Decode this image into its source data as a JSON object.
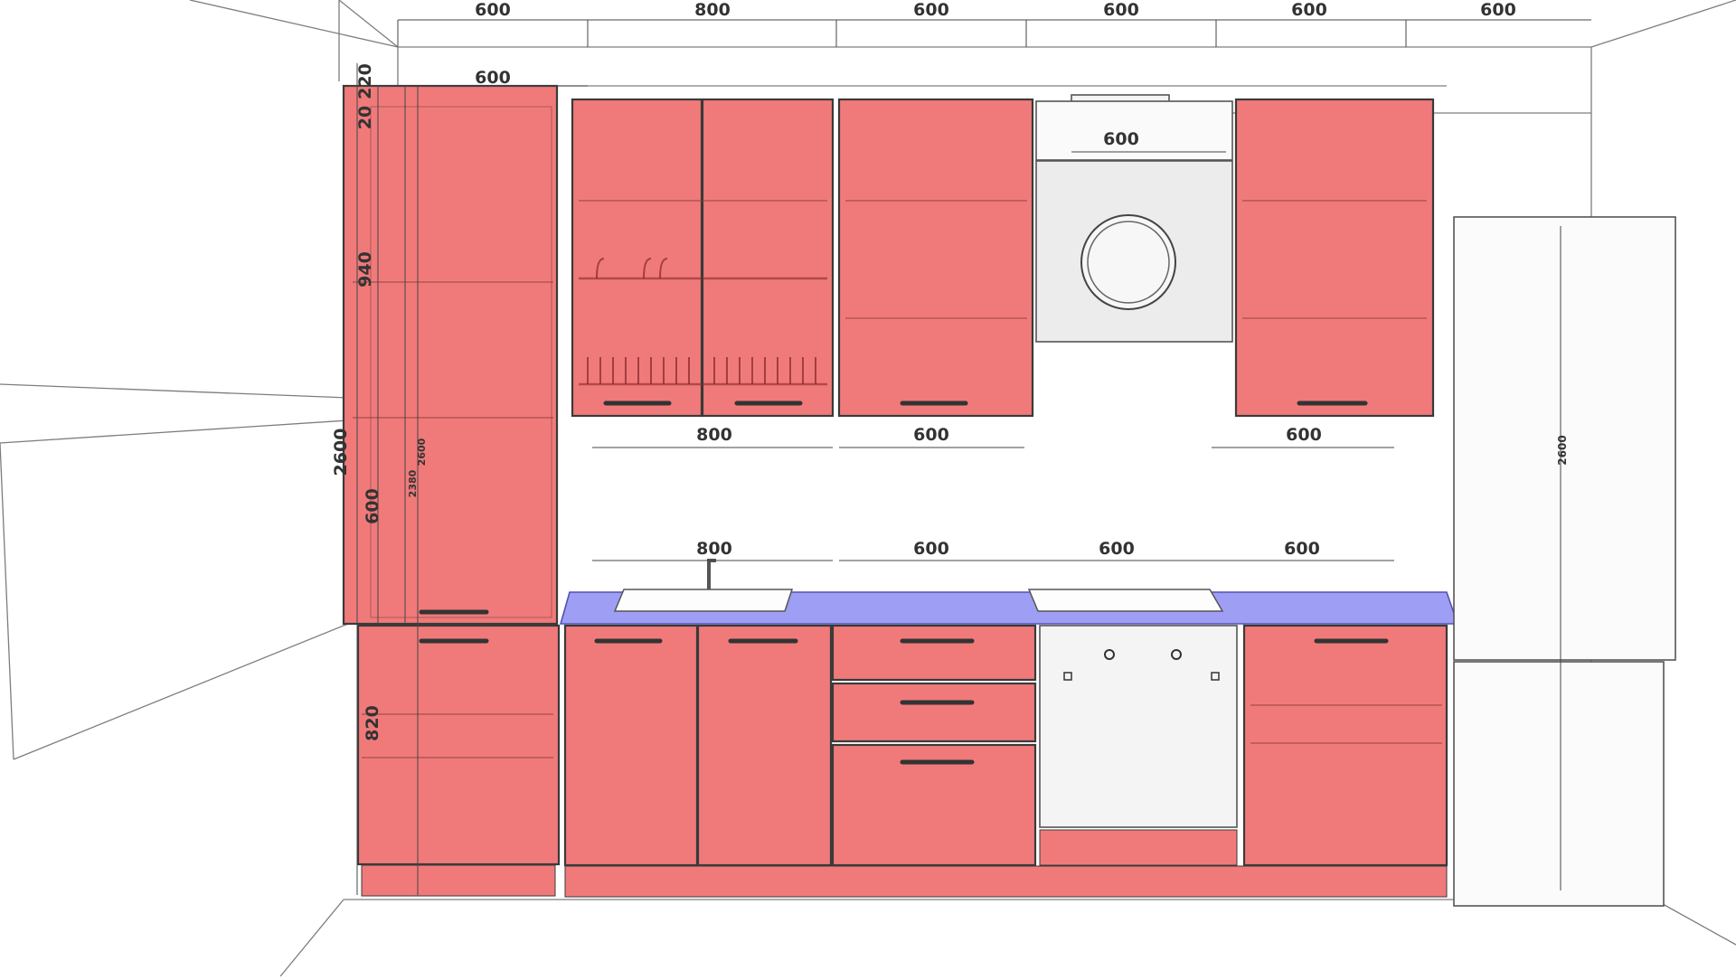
{
  "widths_top": [
    "600",
    "800",
    "600",
    "600",
    "600",
    "600"
  ],
  "tall": {
    "width": "600",
    "dim_220": "220",
    "dim_20": "20",
    "dim_940": "940",
    "dim_600": "600",
    "dim_820": "820",
    "dim_2380": "2380",
    "dim_2600_inner": "2600"
  },
  "height_total": "2600",
  "hood_width": "600",
  "upper_widths": [
    "800",
    "600",
    "600"
  ],
  "lower_widths": [
    "800",
    "600",
    "600",
    "600"
  ],
  "fridge_height": "2600",
  "colors": {
    "cabinet": "#f07a7a",
    "countertop": "#9e9ef5",
    "appliance": "#f4f4f4"
  }
}
